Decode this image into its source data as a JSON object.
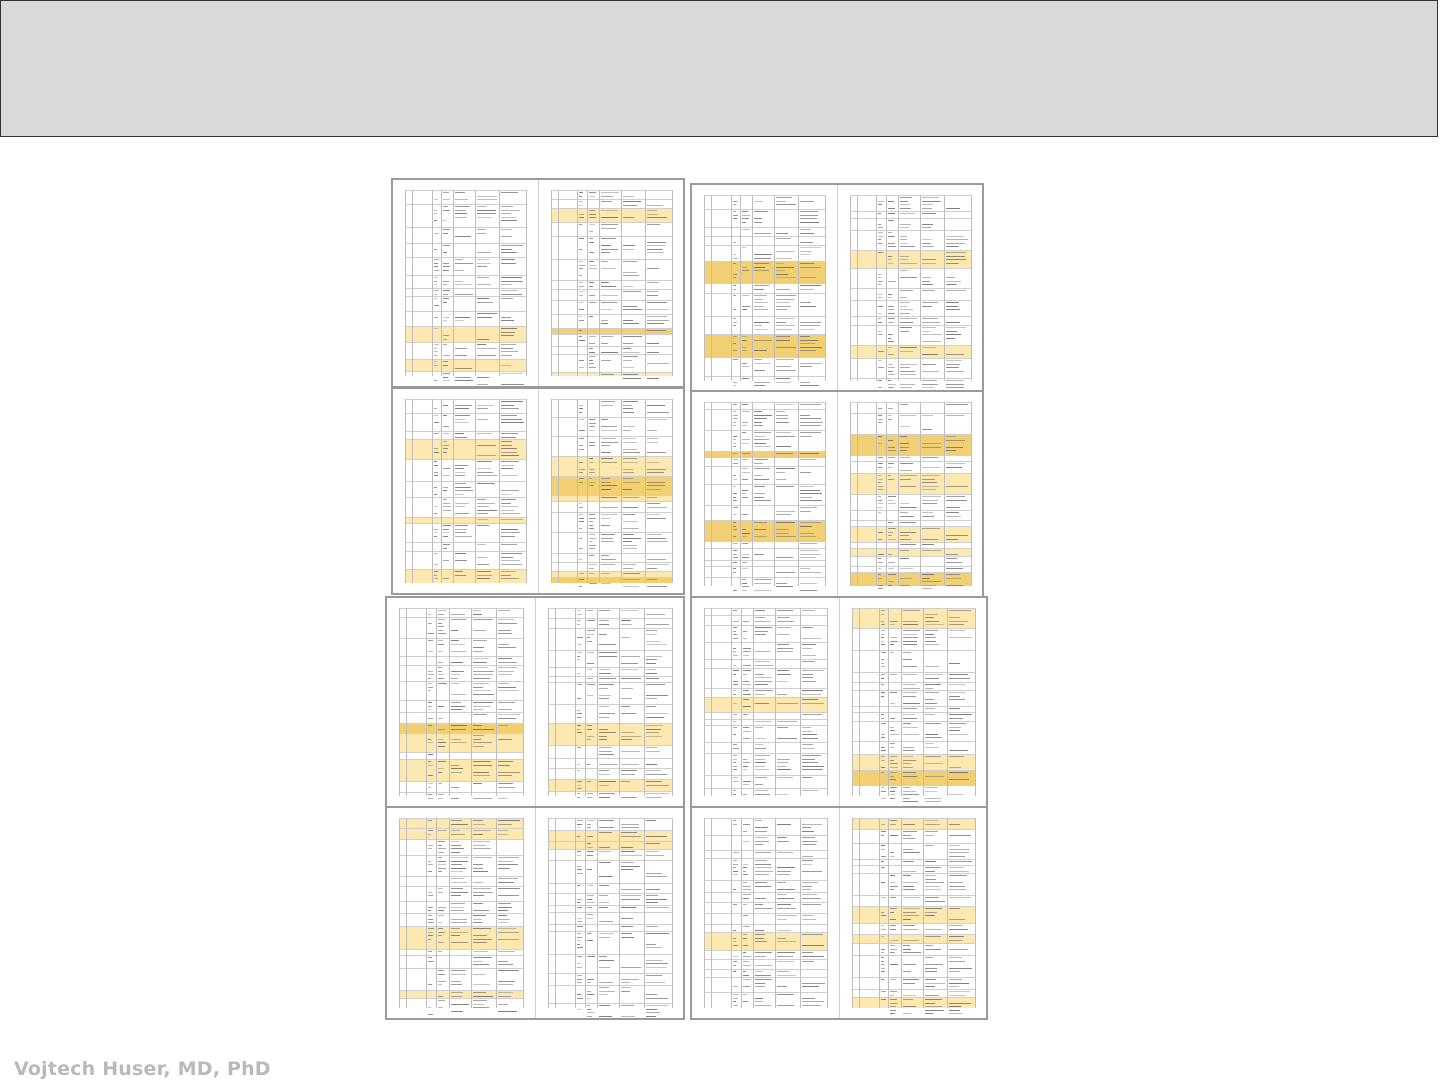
{
  "slide": {
    "title": "",
    "author": "Vojtech Huser, MD, PhD"
  },
  "thumbnails": [
    {
      "name": "spread-1",
      "pages": 2
    },
    {
      "name": "spread-2",
      "pages": 2
    },
    {
      "name": "spread-3",
      "pages": 2
    },
    {
      "name": "spread-4",
      "pages": 2
    },
    {
      "name": "spread-5",
      "pages": 2
    },
    {
      "name": "spread-6",
      "pages": 2
    },
    {
      "name": "spread-7",
      "pages": 2
    },
    {
      "name": "spread-8",
      "pages": 2
    }
  ],
  "colors": {
    "header_band": "#d9d9d9",
    "table_highlight": "#fde9b0",
    "table_header": "#f3cf74",
    "author_text": "#b9b9b9"
  }
}
